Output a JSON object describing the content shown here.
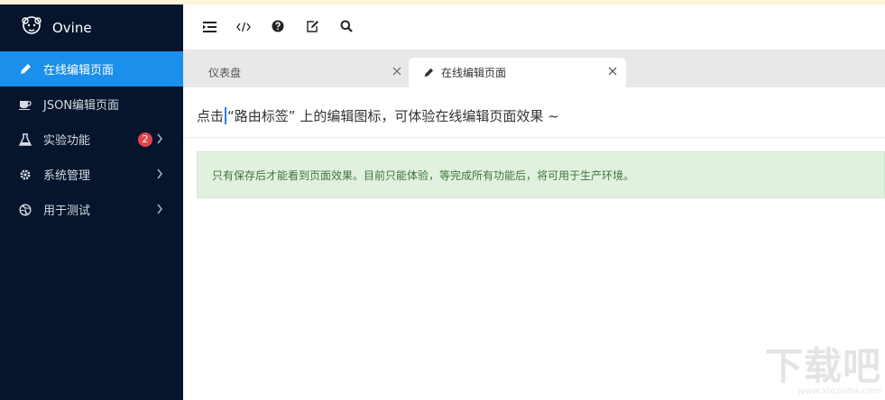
{
  "app": {
    "name": "Ovine"
  },
  "sidebar": {
    "items": [
      {
        "label": "在线编辑页面"
      },
      {
        "label": "JSON编辑页面"
      },
      {
        "label": "实验功能",
        "badge": "2"
      },
      {
        "label": "系统管理"
      },
      {
        "label": "用于测试"
      }
    ]
  },
  "tabs": [
    {
      "label": "仪表盘"
    },
    {
      "label": "在线编辑页面"
    }
  ],
  "content": {
    "headline_before": "点击",
    "headline_after": "“路由标签” 上的编辑图标，可体验在线编辑页面效果 ~",
    "notice": "只有保存后才能看到页面效果。目前只能体验，等完成所有功能后，将可用于生产环境。"
  },
  "watermark": {
    "text": "下载吧",
    "url": "www.xiazaiba.com"
  },
  "colors": {
    "sidebar_bg": "#06152b",
    "active_item": "#1a8fec",
    "badge": "#e0454f",
    "notice_bg": "#e2f1df",
    "notice_text": "#3c763d"
  }
}
